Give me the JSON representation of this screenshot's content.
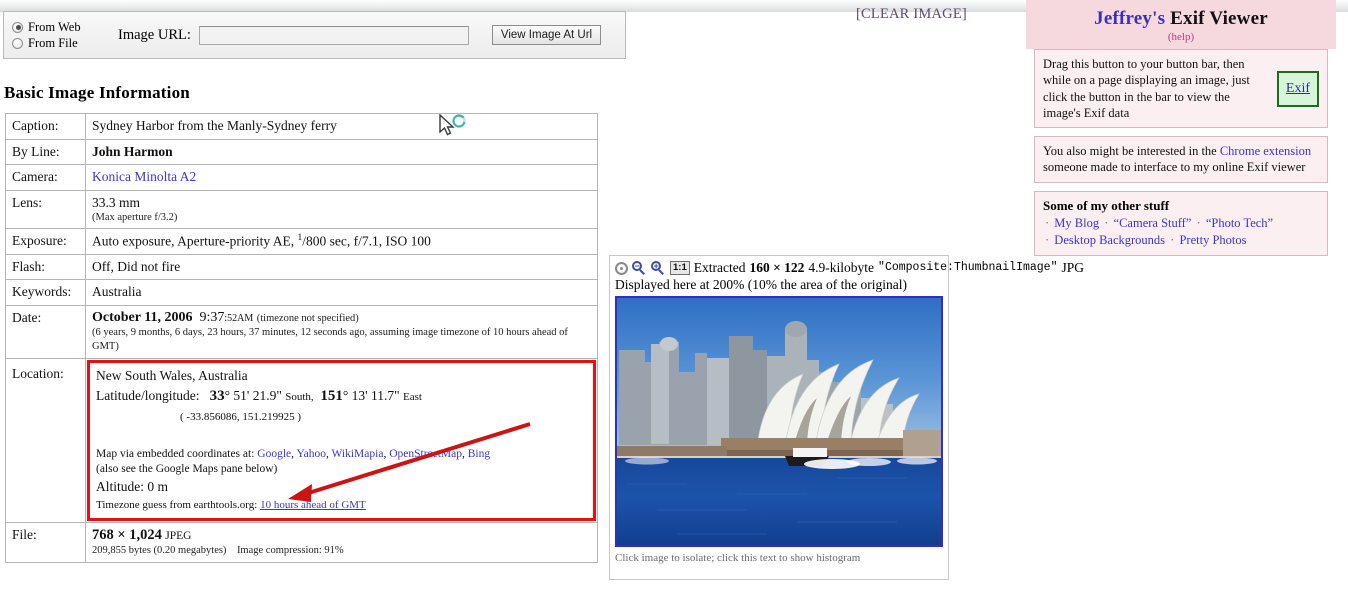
{
  "loader": {
    "radio_web": "From Web",
    "radio_file": "From File",
    "selected": "From Web",
    "url_label": "Image URL:",
    "url_value": "",
    "url_placeholder": "",
    "view_button": "View Image At Url"
  },
  "clear_image_link": "[CLEAR IMAGE]",
  "section_title": "Basic Image Information",
  "table": {
    "caption": {
      "key": "Caption:",
      "value": "Sydney Harbor from the Manly-Sydney ferry"
    },
    "byline": {
      "key": "By Line:",
      "value": "John Harmon"
    },
    "camera": {
      "key": "Camera:",
      "value": "Konica Minolta A2"
    },
    "lens": {
      "key": "Lens:",
      "value": "33.3 mm",
      "note": "(Max aperture f/3.2)"
    },
    "exposure": {
      "key": "Exposure:",
      "pre": "Auto exposure, Aperture-priority AE,",
      "shutter_num": "1",
      "shutter_den": "/800 sec,",
      "post": "f/7.1, ISO 100"
    },
    "flash": {
      "key": "Flash:",
      "value": "Off, Did not fire"
    },
    "keywords": {
      "key": "Keywords:",
      "value": "Australia"
    },
    "date": {
      "key": "Date:",
      "day": "October 11, 2006",
      "time": "9:37",
      "time_sec": ":52AM",
      "tz": "(timezone not specified)",
      "note": "(6 years, 9 months, 6 days, 23 hours, 37 minutes, 12 seconds ago, assuming image timezone of 10 hours ahead of GMT)"
    },
    "location": {
      "key": "Location:",
      "place": "New South Wales, Australia",
      "latlon_label": "Latitude/longitude:",
      "lat_deg": "33",
      "lat_rest": "° 51' 21.9\"",
      "lat_dir": "South,",
      "lon_deg": "151",
      "lon_rest": "° 13' 11.7\"",
      "lon_dir": "East",
      "decimal": "( -33.856086, 151.219925 )",
      "map_prefix": "Map via embedded coordinates at:",
      "map_links": [
        "Google",
        "Yahoo",
        "WikiMapia",
        "OpenStreetMap",
        "Bing"
      ],
      "map_note": "(also see the Google Maps pane below)",
      "altitude_label": "Altitude:",
      "altitude_value": "0 m",
      "tz_prefix": "Timezone guess from earthtools.org:",
      "tz_link": "10 hours ahead of GMT"
    },
    "file": {
      "key": "File:",
      "dims": "768 × 1,024",
      "format": "JPEG",
      "bytes": "209,855 bytes (0.20 megabytes)",
      "compression": "Image compression: 91%"
    }
  },
  "thumbnail_panel": {
    "icons": [
      "reset-icon",
      "zoom-out-icon",
      "zoom-in-icon",
      "one-to-one-icon"
    ],
    "one_to_one_label": "1:1",
    "head_pre": "Extracted",
    "head_dims": "160 × 122",
    "head_size": "4.9-kilobyte",
    "head_tag": "\"Composite:ThumbnailImage\"",
    "head_format": "JPG",
    "subhead": "Displayed here at 200% (10% the area of the original)",
    "caption": "Click image to isolate; click this text to show histogram",
    "image_alt": "Sydney Opera House from the harbor",
    "border_color": "#2f2fc8"
  },
  "sidebar": {
    "title_first": "Jeffrey's",
    "title_rest": "Exif Viewer",
    "help": "(help)",
    "drag_text": "Drag this button to your button bar, then while on a page displaying an image, just click the button in the bar to view the image's Exif data",
    "exif_button": "Exif",
    "chrome_pre": "You also might be interested in the",
    "chrome_link": "Chrome extension",
    "chrome_post": "someone made to interface to my online Exif viewer",
    "other_title": "Some of my other stuff",
    "other_links_row1": [
      "My Blog",
      "“Camera Stuff”",
      "“Photo Tech”"
    ],
    "other_links_row2": [
      "Desktop Backgrounds",
      "Pretty Photos"
    ],
    "bg_color": "#f6d9de"
  },
  "annotation": {
    "box_color": "#e01414",
    "arrow_color": "#cc1414"
  }
}
